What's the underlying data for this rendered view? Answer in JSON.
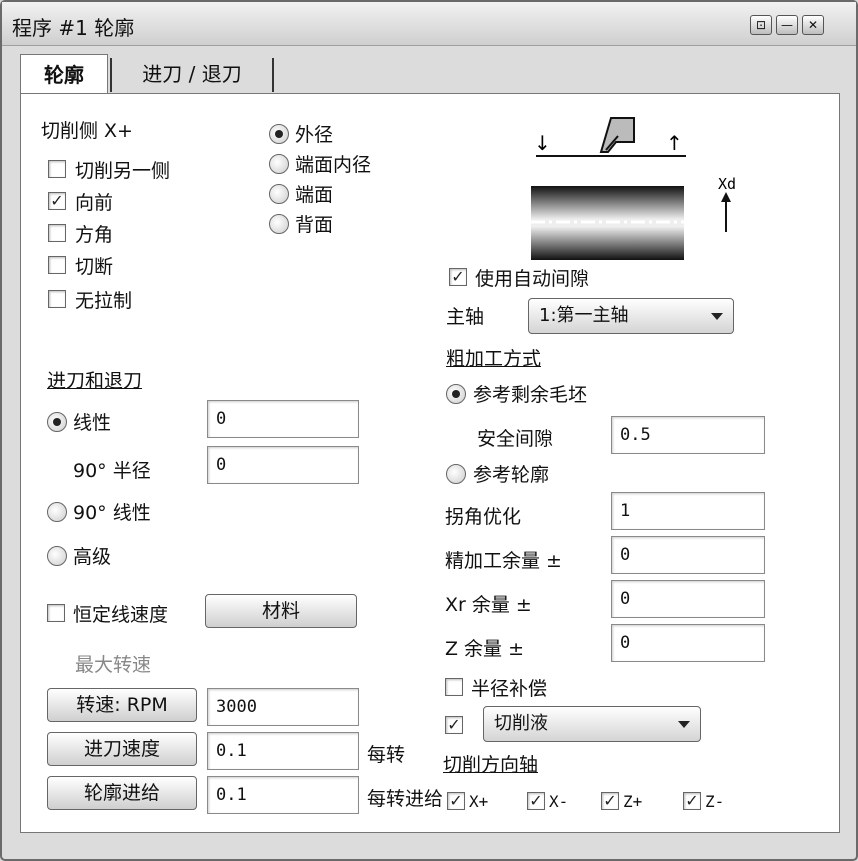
{
  "window": {
    "title": "程序 #1 轮廓",
    "buttons": {
      "pin": "⊡",
      "min": "—",
      "close": "✕"
    }
  },
  "tabs": [
    {
      "label": "轮廓",
      "active": true
    },
    {
      "label": "进刀 / 退刀",
      "active": false
    }
  ],
  "cut_side": {
    "label": "切削侧 X+",
    "options": [
      {
        "label": "切削另一侧",
        "checked": false
      },
      {
        "label": "向前",
        "checked": true
      },
      {
        "label": "方角",
        "checked": false
      },
      {
        "label": "切断",
        "checked": false
      },
      {
        "label": "无拉制",
        "checked": false
      }
    ]
  },
  "diameter_type": {
    "options": [
      {
        "label": "外径",
        "selected": true
      },
      {
        "label": "端面内径",
        "selected": false
      },
      {
        "label": "端面",
        "selected": false
      },
      {
        "label": "背面",
        "selected": false
      }
    ]
  },
  "diagram": {
    "axis_label": "Xd"
  },
  "auto_gap": {
    "label": "使用自动间隙",
    "checked": true
  },
  "spindle": {
    "label": "主轴",
    "value": "1:第一主轴"
  },
  "roughing": {
    "heading": "粗加工方式",
    "option_stock": {
      "label": "参考剩余毛坯",
      "selected": true
    },
    "safe_gap": {
      "label": "安全间隙",
      "value": "0.5"
    },
    "option_contour": {
      "label": "参考轮廓",
      "selected": false
    },
    "corner_opt": {
      "label": "拐角优化",
      "value": "1"
    },
    "finish_allow": {
      "label": "精加工余量 ±",
      "value": "0"
    },
    "xr_allow": {
      "label": "Xr 余量 ±",
      "value": "0"
    },
    "z_allow": {
      "label": "Z 余量 ±",
      "value": "0"
    }
  },
  "lead_in_out": {
    "heading": "进刀和退刀",
    "linear": {
      "label": "线性",
      "selected": true,
      "value": "0"
    },
    "radius": {
      "label": "90° 半径",
      "value": "0"
    },
    "linear90": {
      "label": "90° 线性",
      "selected": false
    },
    "advanced": {
      "label": "高级",
      "selected": false
    }
  },
  "const_speed": {
    "label": "恒定线速度",
    "checked": false
  },
  "material_button": "材料",
  "max_speed_label": "最大转速",
  "speed": {
    "button": "转速: RPM",
    "value": "3000"
  },
  "feed": {
    "button": "进刀速度",
    "value": "0.1",
    "unit": "每转"
  },
  "contour_feed": {
    "button": "轮廓进给",
    "value": "0.1",
    "unit": "每转进给"
  },
  "radius_comp": {
    "label": "半径补偿",
    "checked": false
  },
  "coolant": {
    "checked": true,
    "value": "切削液"
  },
  "cut_axis": {
    "heading": "切削方向轴",
    "items": [
      {
        "label": "X+",
        "checked": true
      },
      {
        "label": "X-",
        "checked": true
      },
      {
        "label": "Z+",
        "checked": true
      },
      {
        "label": "Z-",
        "checked": true
      }
    ]
  }
}
